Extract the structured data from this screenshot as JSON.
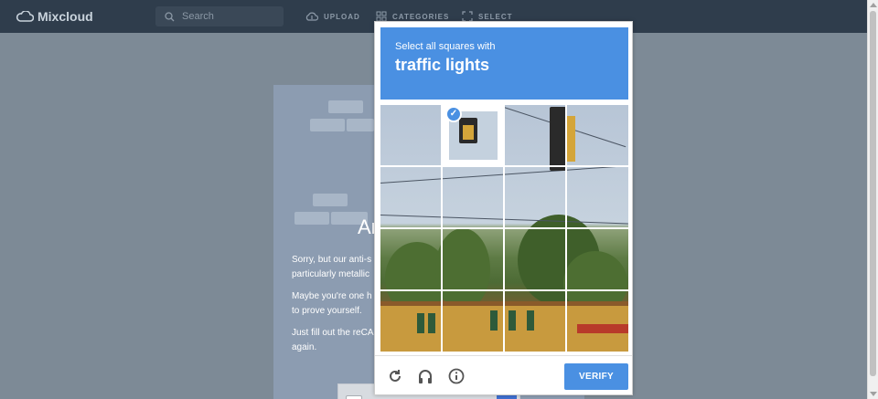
{
  "app": {
    "brand": "Mixcloud"
  },
  "nav": {
    "search_placeholder": "Search",
    "upload_label": "UPLOAD",
    "categories_label": "CATEGORIES",
    "select_label": "SELECT"
  },
  "card": {
    "heading": "Ar",
    "p1": "Sorry, but our anti-s particularly metallic",
    "p2": "Maybe you're one h to prove yourself.",
    "p3": "Just fill out the reCA again."
  },
  "captcha": {
    "instruction": "Select all squares with",
    "target": "traffic lights",
    "verify_label": "VERIFY",
    "selected_tile": "row 1, column 2",
    "colors": {
      "accent": "#4a90e2"
    }
  },
  "icons": {
    "reload": "reload-icon",
    "audio": "headphones-icon",
    "info": "info-icon",
    "check": "checkmark-icon"
  }
}
